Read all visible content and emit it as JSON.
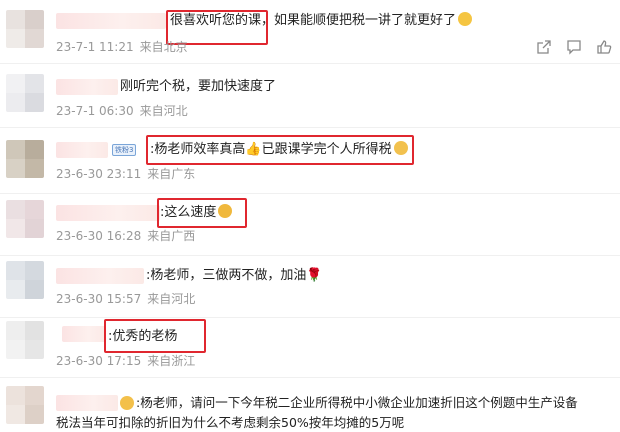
{
  "comments": [
    {
      "text": "很喜欢听您的课，如果能顺便把税一讲了就更好了",
      "date": "23-7-1 11:21",
      "location": "来自北京"
    },
    {
      "text": "刚听完个税，要加快速度了",
      "date": "23-7-1 06:30",
      "location": "来自河北"
    },
    {
      "text": ":杨老师效率真高👍已跟课学完个人所得税",
      "date": "23-6-30 23:11",
      "location": "来自广东",
      "badge": "铁粉3"
    },
    {
      "text": ":这么速度",
      "date": "23-6-30 16:28",
      "location": "来自广西"
    },
    {
      "text": ":杨老师，三做两不做，加油🌹",
      "date": "23-6-30 15:57",
      "location": "来自河北"
    },
    {
      "text": ":优秀的老杨",
      "date": "23-6-30 17:15",
      "location": "来自浙江"
    },
    {
      "text": ":杨老师，请问一下今年税二企业所得税中小微企业加速折旧这个例题中生产设备",
      "text_line2": "税法当年可扣除的折旧为什么不考虑剩余50%按年均摊的5万呢"
    }
  ],
  "colors": {
    "highlight": "#e0272f",
    "meta": "#999999",
    "text": "#222222"
  },
  "icons": [
    "share-icon",
    "comment-icon",
    "like-icon"
  ]
}
